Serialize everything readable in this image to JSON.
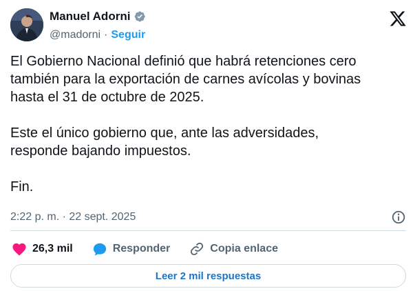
{
  "author": {
    "name": "Manuel Adorni",
    "handle": "@madorni",
    "separator": "·",
    "follow_label": "Seguir"
  },
  "tweet": {
    "text": "El Gobierno Nacional definió que habrá retenciones cero\ntambién para la exportación de carnes avícolas y bovinas\nhasta el 31 de octubre de 2025.\n\nEste el único gobierno que, ante las adversidades,\nresponde bajando impuestos.\n\nFin.",
    "timestamp": "2:22 p. m. · 22 sept. 2025"
  },
  "actions": {
    "likes": "26,3 mil",
    "reply_label": "Responder",
    "copy_label": "Copia enlace"
  },
  "replies_button": "Leer 2 mil respuestas",
  "colors": {
    "accent": "#1d9bf0",
    "like": "#f91880",
    "text": "#0f1419",
    "muted": "#536471"
  }
}
